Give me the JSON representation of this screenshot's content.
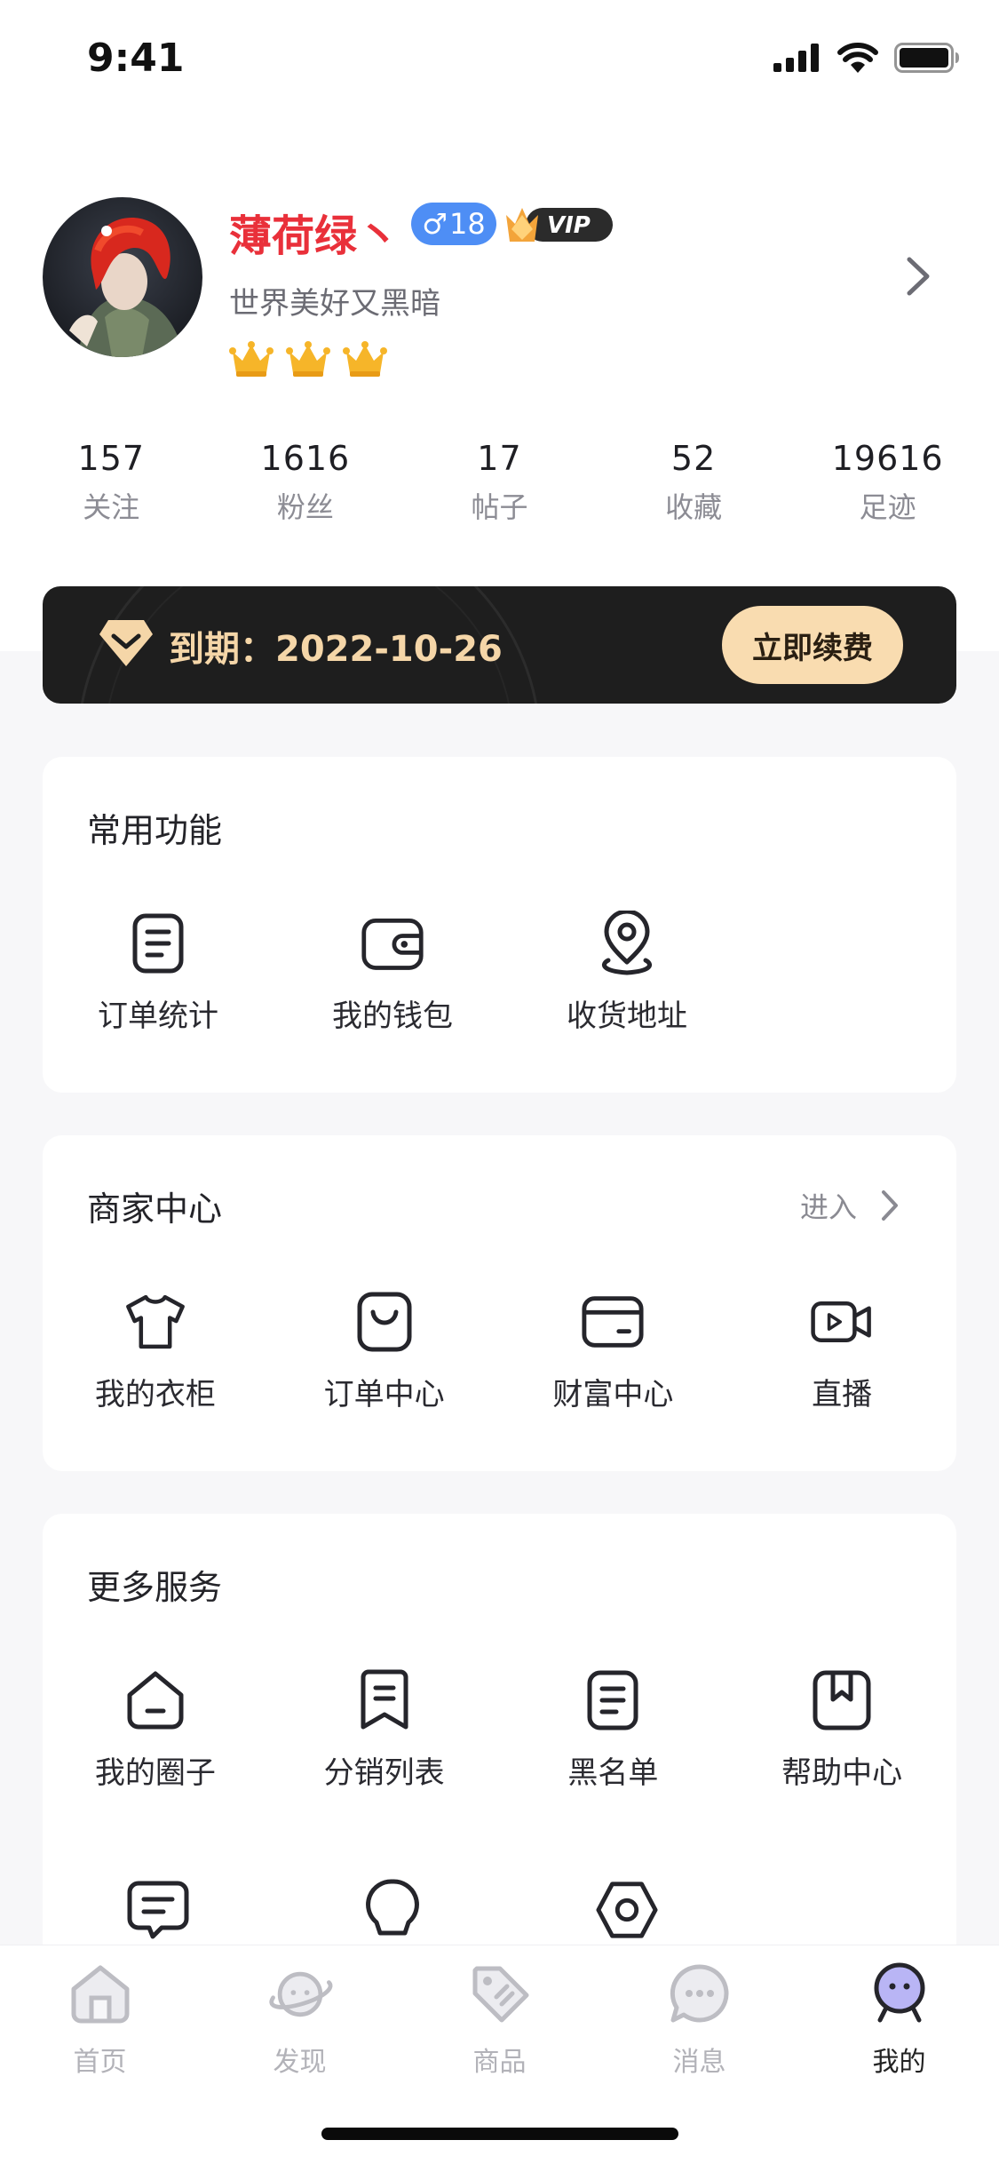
{
  "status": {
    "time": "9:41"
  },
  "profile": {
    "username": "薄荷绿丶",
    "gender_symbol": "♂",
    "age": "18",
    "vip_badge": "VIP",
    "signature": "世界美好又黑暗",
    "crown_count": 3
  },
  "stats": [
    {
      "value": "157",
      "label": "关注"
    },
    {
      "value": "1616",
      "label": "粉丝"
    },
    {
      "value": "17",
      "label": "帖子"
    },
    {
      "value": "52",
      "label": "收藏"
    },
    {
      "value": "19616",
      "label": "足迹"
    }
  ],
  "vip_bar": {
    "expiry": "到期：2022-10-26",
    "renew_label": "立即续费"
  },
  "common": {
    "title": "常用功能",
    "items": [
      {
        "label": "订单统计",
        "icon": "document-icon"
      },
      {
        "label": "我的钱包",
        "icon": "wallet-icon"
      },
      {
        "label": "收货地址",
        "icon": "location-pin-icon"
      }
    ]
  },
  "merchant": {
    "title": "商家中心",
    "enter_label": "进入",
    "items": [
      {
        "label": "我的衣柜",
        "icon": "tshirt-icon"
      },
      {
        "label": "订单中心",
        "icon": "shopping-bag-icon"
      },
      {
        "label": "财富中心",
        "icon": "card-icon"
      },
      {
        "label": "直播",
        "icon": "video-camera-icon"
      }
    ]
  },
  "more": {
    "title": "更多服务",
    "items": [
      {
        "label": "我的圈子",
        "icon": "house-icon"
      },
      {
        "label": "分销列表",
        "icon": "bookmark-list-icon"
      },
      {
        "label": "黑名单",
        "icon": "list-icon"
      },
      {
        "label": "帮助中心",
        "icon": "help-bookmark-icon"
      }
    ],
    "row2_icons": [
      "message-icon",
      "bulb-icon",
      "settings-hexagon-icon"
    ]
  },
  "tabbar": {
    "items": [
      {
        "label": "首页",
        "icon": "home-icon",
        "active": false
      },
      {
        "label": "发现",
        "icon": "planet-icon",
        "active": false
      },
      {
        "label": "商品",
        "icon": "tag-icon",
        "active": false
      },
      {
        "label": "消息",
        "icon": "chat-icon",
        "active": false
      },
      {
        "label": "我的",
        "icon": "profile-icon",
        "active": true
      }
    ]
  },
  "colors": {
    "username": "#E9303A",
    "gender_badge": "#4E8EF5",
    "vip_bar_bg": "#1E1E1E",
    "vip_text": "#F5D6A8",
    "renew_button": "#F9DCB0"
  }
}
